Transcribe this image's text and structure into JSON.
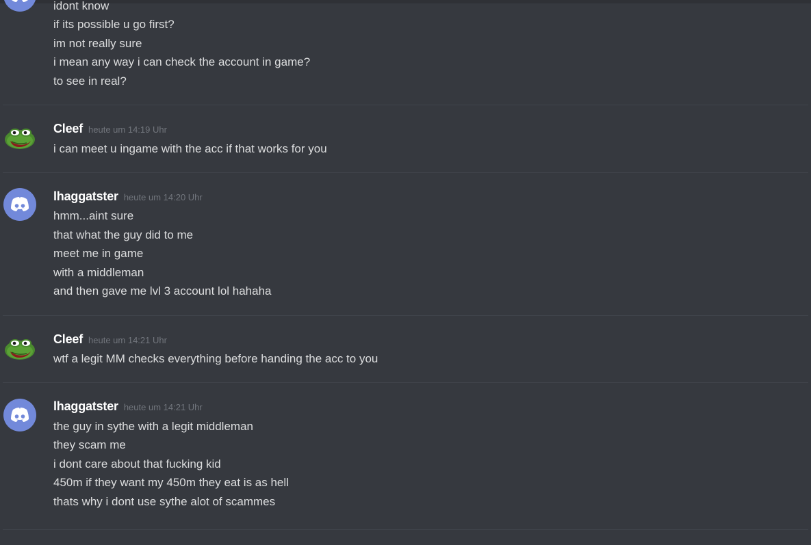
{
  "messages": [
    {
      "author": "",
      "timestamp": "",
      "avatar": "discord-icon",
      "lines": [
        "idont know",
        "if its possible u go first?",
        "im not really sure",
        "i mean any way i can check the account in game?",
        "to see in real?"
      ]
    },
    {
      "author": "Cleef",
      "timestamp": "heute um 14:19 Uhr",
      "avatar": "pepe-frog-icon",
      "lines": [
        "i can meet u ingame with the acc if that works for you"
      ]
    },
    {
      "author": "lhaggatster",
      "timestamp": "heute um 14:20 Uhr",
      "avatar": "discord-icon",
      "lines": [
        "hmm...aint sure",
        "that what the guy did to me",
        "meet me in game",
        "with a middleman",
        "and then gave me lvl 3 account lol hahaha"
      ]
    },
    {
      "author": "Cleef",
      "timestamp": "heute um 14:21 Uhr",
      "avatar": "pepe-frog-icon",
      "lines": [
        "wtf a legit MM checks everything before handing the acc to you"
      ]
    },
    {
      "author": "lhaggatster",
      "timestamp": "heute um 14:21 Uhr",
      "avatar": "discord-icon",
      "lines": [
        "the guy in sythe with a legit middleman",
        "they scam me",
        "i dont care about that fucking kid",
        "450m if they want my 450m they eat is as hell",
        "thats why i dont use sythe alot of scammes"
      ]
    }
  ],
  "colors": {
    "background": "#36393f",
    "text": "#dcddde",
    "username": "#ffffff",
    "timestamp": "#72767d",
    "discord_blurple": "#7289da"
  }
}
